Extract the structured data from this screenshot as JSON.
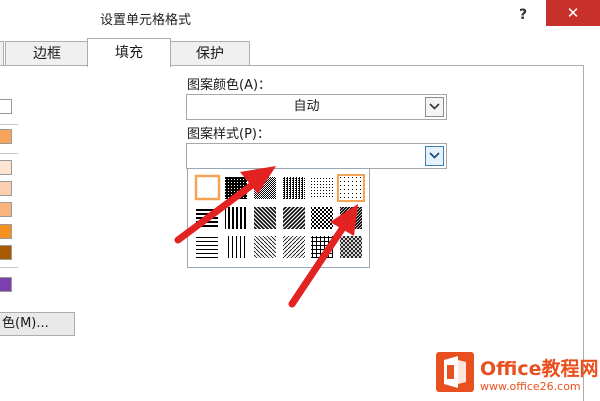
{
  "window": {
    "title": "设置单元格格式",
    "help": "?",
    "close": "✕"
  },
  "tabs": [
    {
      "label": "边框",
      "active": false
    },
    {
      "label": "填充",
      "active": true
    },
    {
      "label": "保护",
      "active": false
    }
  ],
  "left_panel": {
    "swatch_colors": [
      "#ffffff",
      "#f7a35c",
      "#fde5d3",
      "#fbcfb0",
      "#f8b47c",
      "#f39221",
      "#a95a00",
      "#7b3fae"
    ],
    "more_colors_label": "色(M)..."
  },
  "pattern_color": {
    "label": "图案颜色(A)：",
    "value": "自动"
  },
  "pattern_style": {
    "label": "图案样式(P)：",
    "value": ""
  },
  "palette": {
    "selected_index": 0,
    "cells": [
      "solid-white",
      "dense-75",
      "dense-50",
      "medium-vertical",
      "sparse-dots",
      "sparse-dots-selected",
      "horizontal-lines",
      "vertical-lines",
      "diagonal-down",
      "diagonal-up",
      "checker-grid",
      "dense-diagonal",
      "thin-horizontal",
      "thin-vertical",
      "thin-diagonal-down",
      "thin-diagonal-up",
      "thin-grid",
      "thin-crosshatch"
    ]
  },
  "watermark": {
    "brand": "Office教程网",
    "url": "www.office26.com"
  },
  "colors": {
    "accent": "#e8511f",
    "close": "#c7302b",
    "selection": "#f3a455",
    "arrow": "#e32222"
  }
}
